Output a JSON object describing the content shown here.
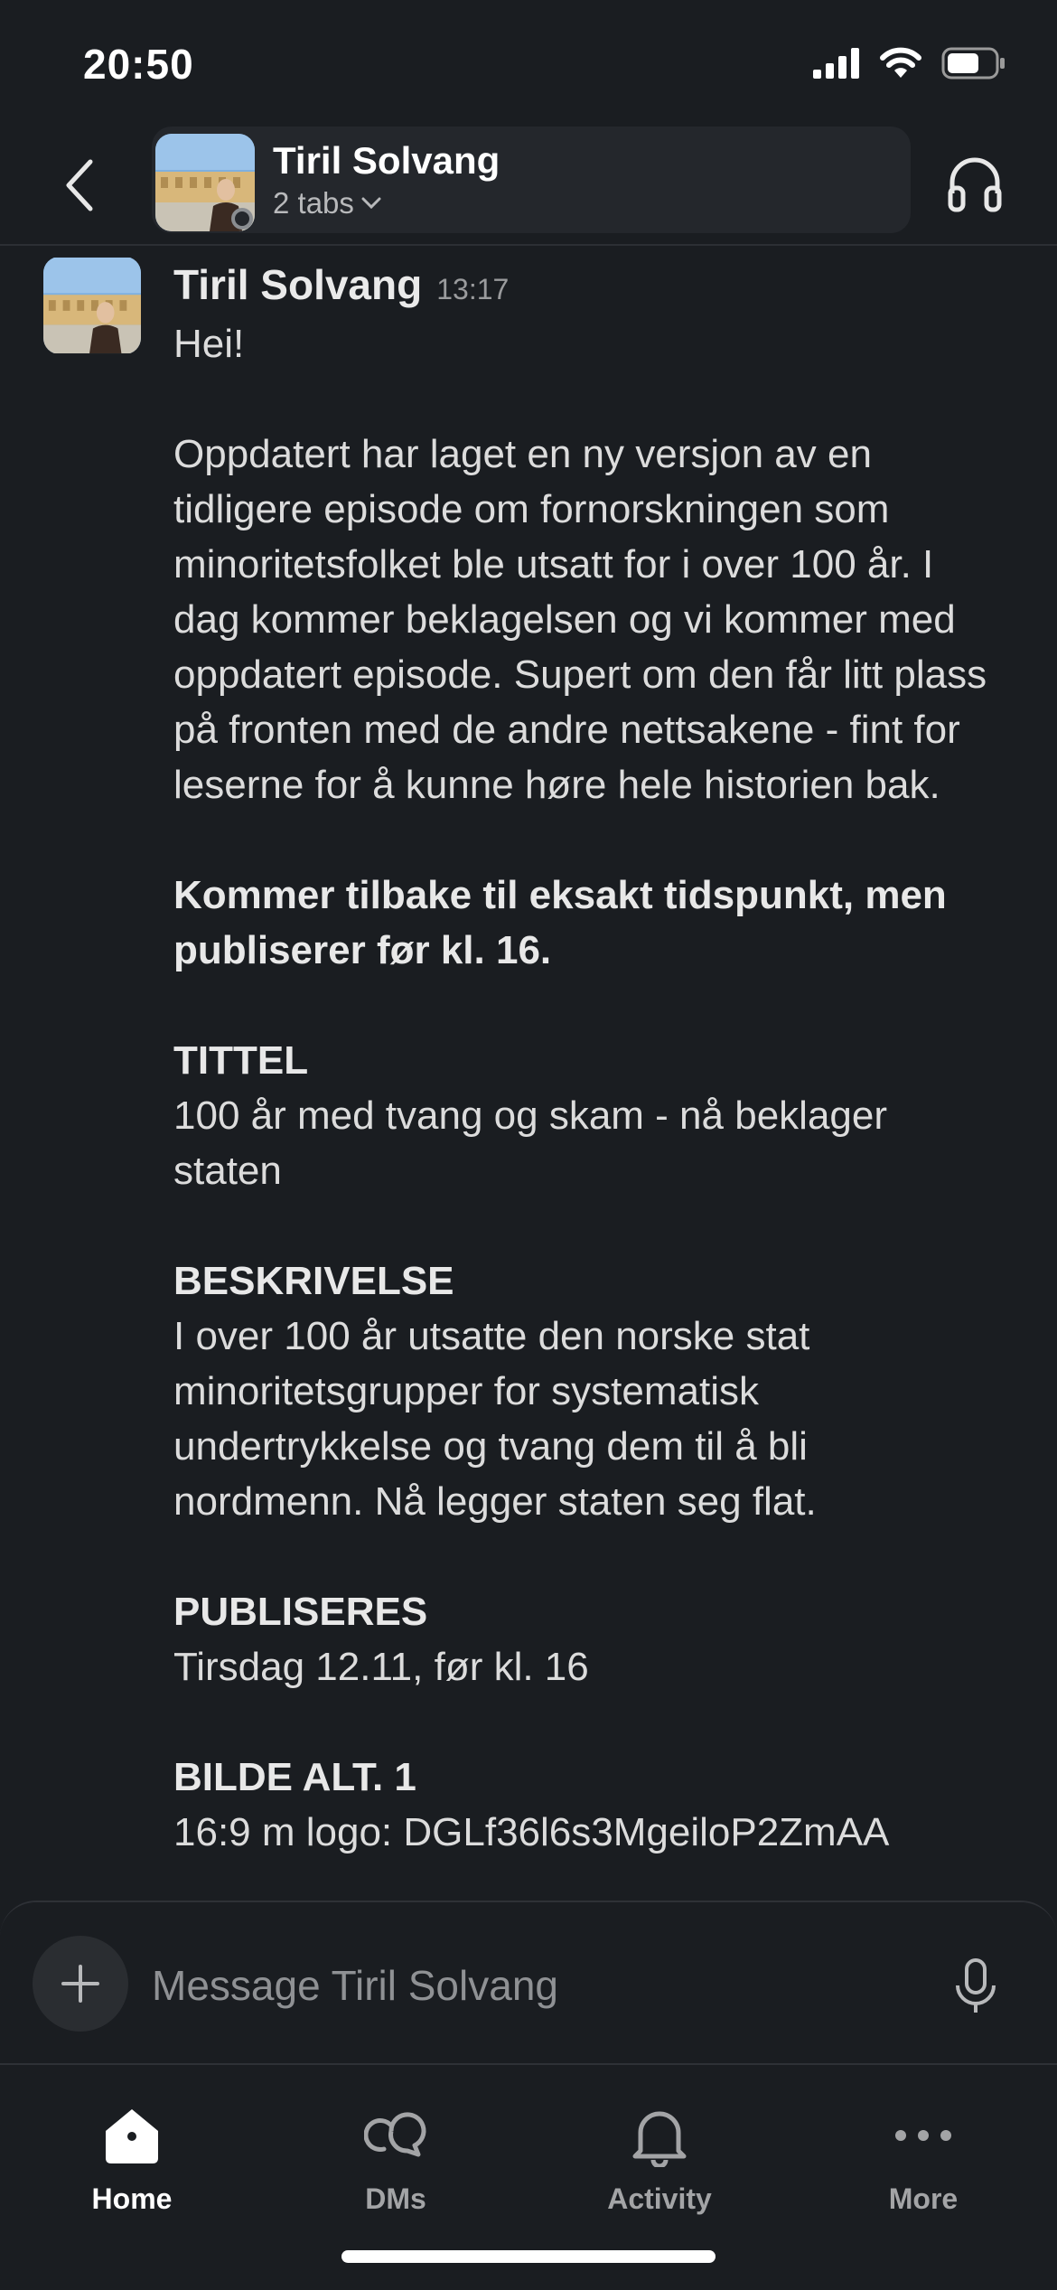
{
  "status_bar": {
    "time": "20:50"
  },
  "header": {
    "name": "Tiril Solvang",
    "subtitle": "2 tabs"
  },
  "message": {
    "author": "Tiril Solvang",
    "time": "13:17",
    "greeting": "Hei!",
    "paragraph": "Oppdatert har laget en ny versjon av en tidligere episode om fornorskningen som minoritetsfolket ble utsatt for i over 100 år. I dag kommer beklagelsen og vi kommer med oppdatert episode. Supert om den får litt plass på fronten med de andre nettsakene - fint for leserne for å kunne høre hele historien bak.",
    "bold_note": "Kommer tilbake til eksakt tidspunkt, men publiserer før kl. 16.",
    "sections": [
      {
        "heading": "TITTEL",
        "text": "100 år med tvang og skam - nå beklager staten"
      },
      {
        "heading": "BESKRIVELSE",
        "text": "I over 100 år utsatte den norske stat minoritetsgrupper for systematisk undertrykkelse og tvang dem til å bli nordmenn. Nå legger staten seg flat."
      },
      {
        "heading": "PUBLISERES",
        "text": "Tirsdag 12.11, før kl. 16"
      },
      {
        "heading": "BILDE ALT. 1",
        "text": "16:9 m logo: DGLf36l6s3MgeiloP2ZmAA"
      }
    ]
  },
  "composer": {
    "placeholder": "Message Tiril Solvang"
  },
  "tabs": [
    {
      "label": "Home",
      "icon": "home-icon"
    },
    {
      "label": "DMs",
      "icon": "dms-icon"
    },
    {
      "label": "Activity",
      "icon": "bell-icon"
    },
    {
      "label": "More",
      "icon": "more-icon"
    }
  ]
}
